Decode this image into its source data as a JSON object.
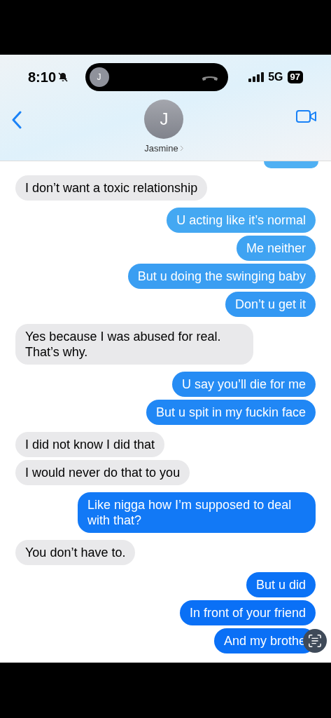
{
  "status_bar": {
    "time": "8:10",
    "network": "5G",
    "battery": "97"
  },
  "call_pill": {
    "initial": "J"
  },
  "contact": {
    "initial": "J",
    "name": "Jasmine"
  },
  "messages": [
    {
      "kind": "cut_outgoing"
    },
    {
      "kind": "incoming",
      "text": "I don’t want a toxic relationship"
    },
    {
      "kind": "outgoing",
      "text": "U acting like it’s normal"
    },
    {
      "kind": "outgoing",
      "text": "Me neither"
    },
    {
      "kind": "outgoing",
      "text": "But u doing the swinging baby"
    },
    {
      "kind": "outgoing",
      "text": "Don’t u get it"
    },
    {
      "kind": "incoming",
      "text": "Yes because I was abused for real. That’s why."
    },
    {
      "kind": "outgoing",
      "text": "U say you’ll die for me"
    },
    {
      "kind": "outgoing",
      "text": "But u spit in my fuckin face"
    },
    {
      "kind": "incoming",
      "text": "I did not know I did that"
    },
    {
      "kind": "incoming",
      "text": "I would never do that to you"
    },
    {
      "kind": "outgoing",
      "text": "Like nigga how I’m supposed to deal with that?"
    },
    {
      "kind": "incoming",
      "text": "You don’t have to."
    },
    {
      "kind": "outgoing",
      "text": "But u did"
    },
    {
      "kind": "outgoing",
      "text": "In front of your friend"
    },
    {
      "kind": "outgoing",
      "text": "And my brothe"
    }
  ]
}
